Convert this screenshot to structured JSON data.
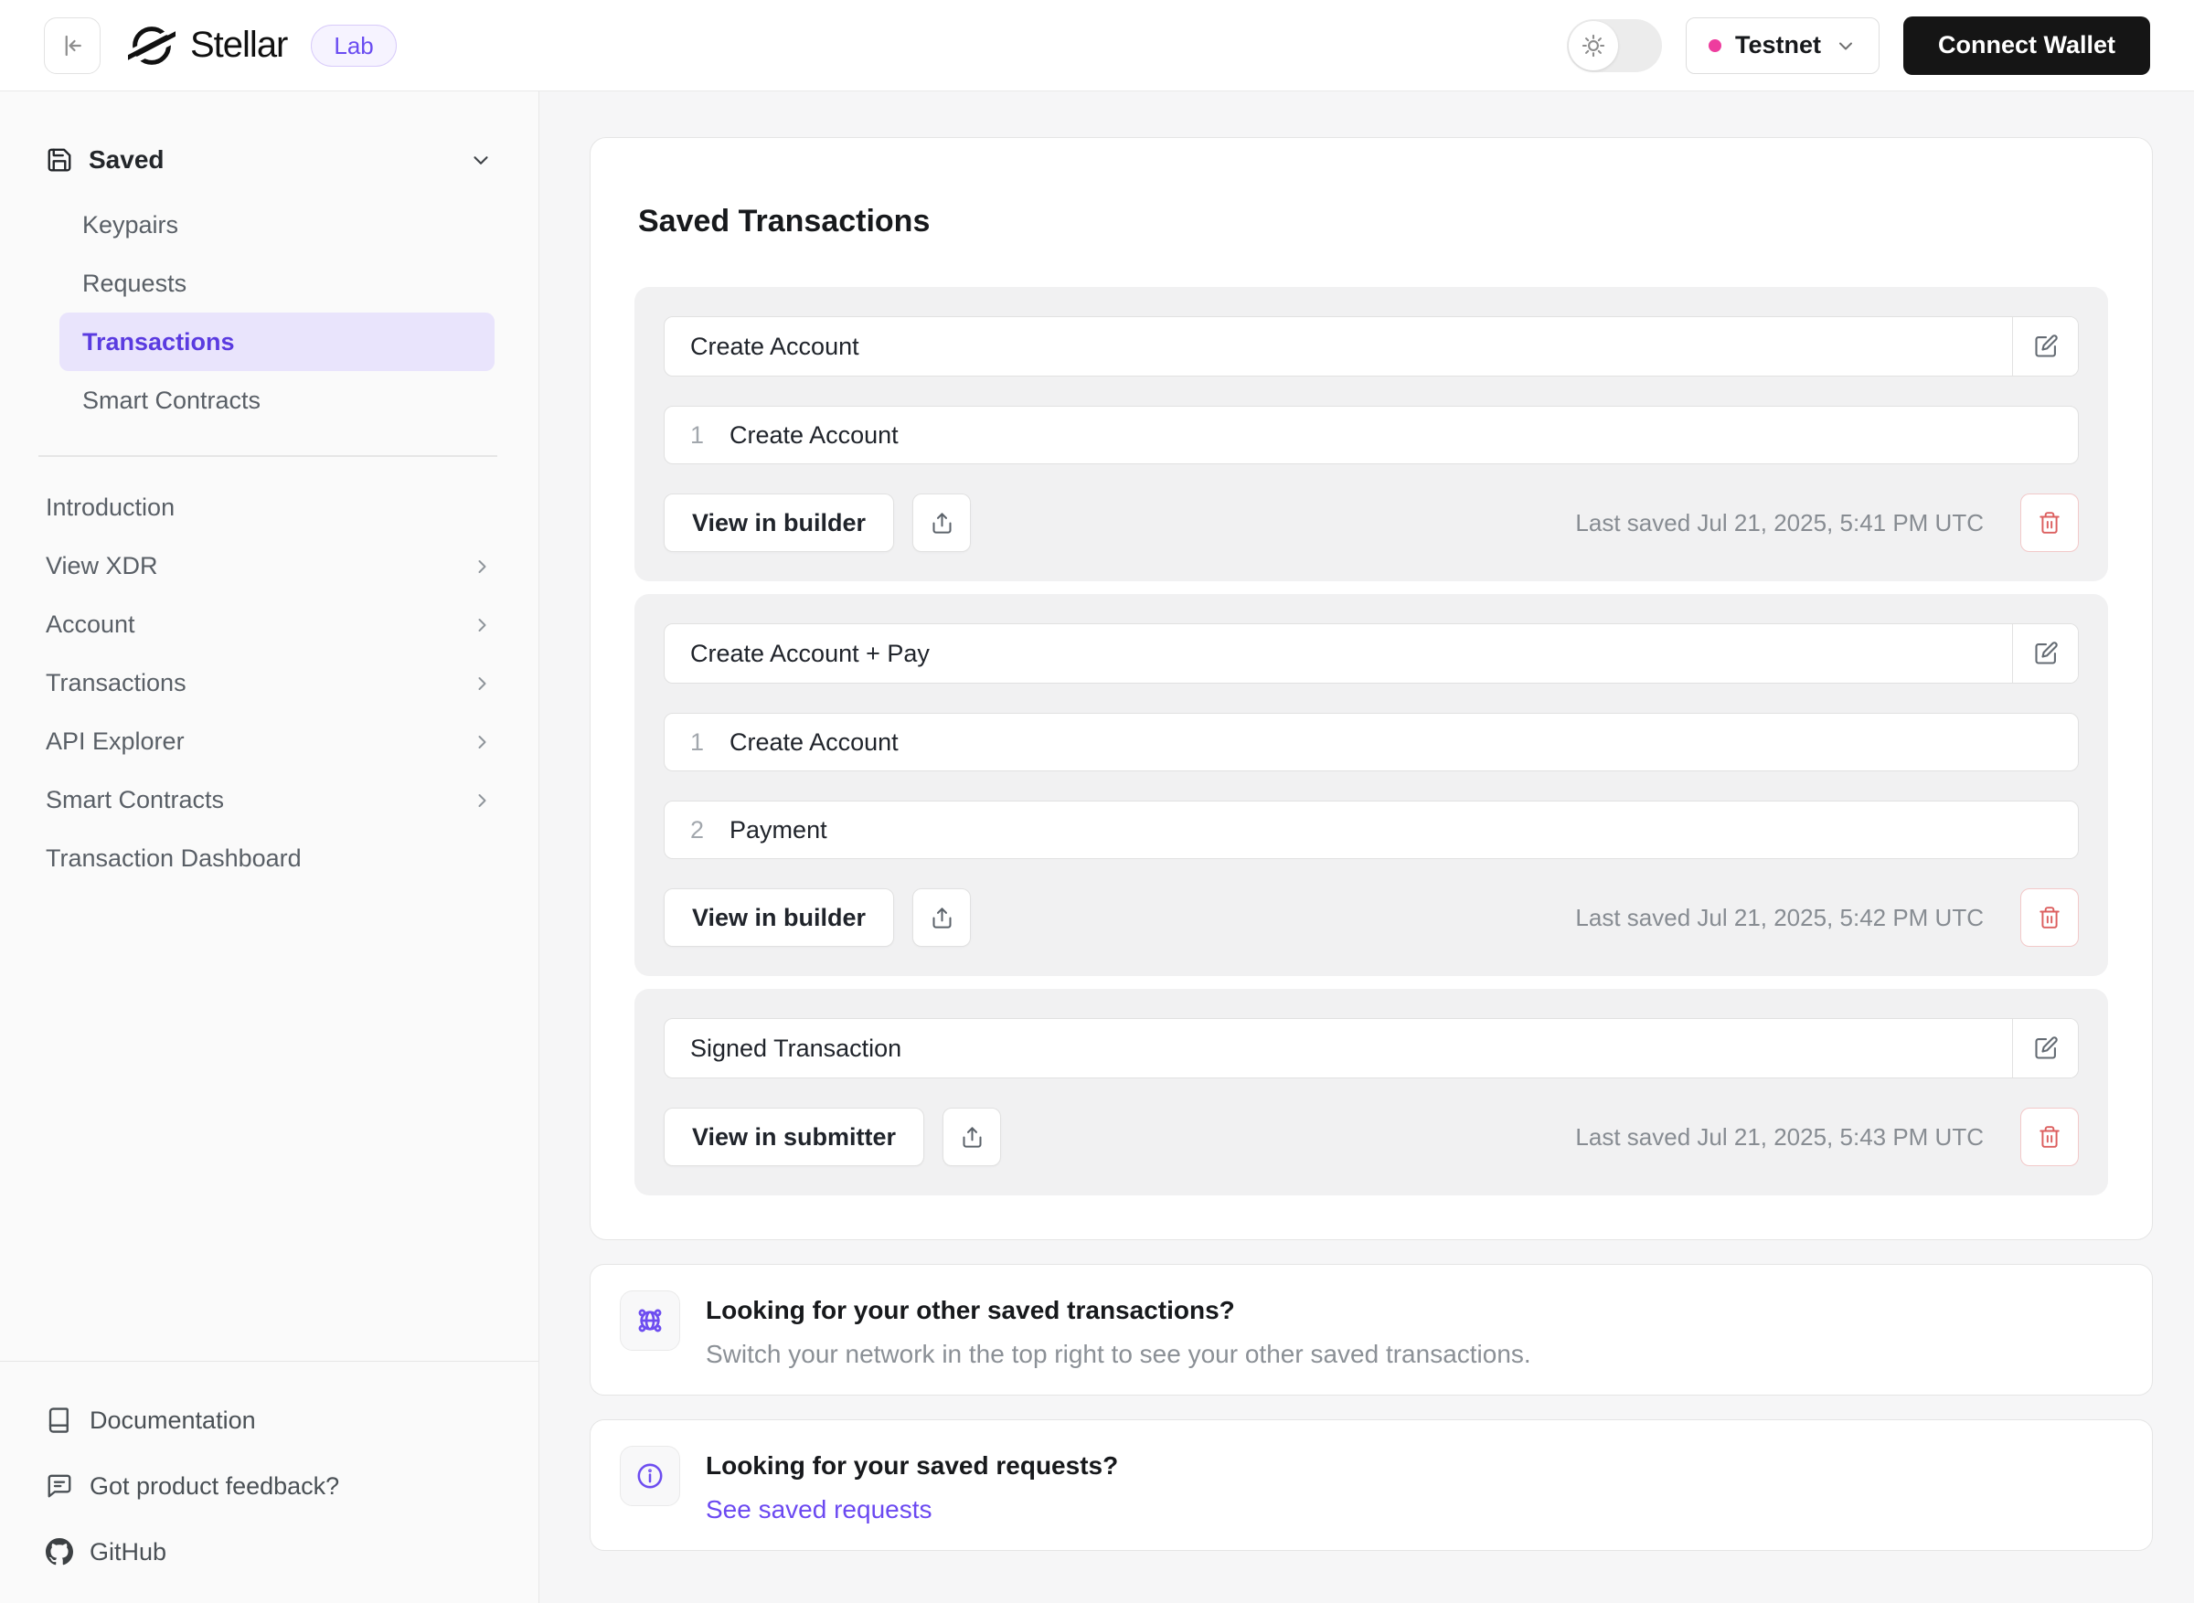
{
  "header": {
    "brand": "Stellar",
    "badge": "Lab",
    "network_label": "Testnet",
    "connect_wallet": "Connect Wallet"
  },
  "sidebar": {
    "saved": {
      "label": "Saved",
      "items": [
        {
          "label": "Keypairs"
        },
        {
          "label": "Requests"
        },
        {
          "label": "Transactions"
        },
        {
          "label": "Smart Contracts"
        }
      ]
    },
    "nav": [
      {
        "label": "Introduction"
      },
      {
        "label": "View XDR"
      },
      {
        "label": "Account"
      },
      {
        "label": "Transactions"
      },
      {
        "label": "API Explorer"
      },
      {
        "label": "Smart Contracts"
      },
      {
        "label": "Transaction Dashboard"
      }
    ],
    "footer": [
      {
        "label": "Documentation"
      },
      {
        "label": "Got product feedback?"
      },
      {
        "label": "GitHub"
      }
    ]
  },
  "main": {
    "title": "Saved Transactions",
    "transactions": [
      {
        "name": "Create Account",
        "operations": [
          {
            "index": "1",
            "label": "Create Account"
          }
        ],
        "action": "View in builder",
        "last_saved": "Last saved Jul 21, 2025, 5:41 PM UTC"
      },
      {
        "name": "Create Account + Pay",
        "operations": [
          {
            "index": "1",
            "label": "Create Account"
          },
          {
            "index": "2",
            "label": "Payment"
          }
        ],
        "action": "View in builder",
        "last_saved": "Last saved Jul 21, 2025, 5:42 PM UTC"
      },
      {
        "name": "Signed Transaction",
        "operations": [],
        "action": "View in submitter",
        "last_saved": "Last saved Jul 21, 2025, 5:43 PM UTC"
      }
    ],
    "info_boxes": [
      {
        "title": "Looking for your other saved transactions?",
        "description": "Switch your network in the top right to see your other saved transactions."
      },
      {
        "title": "Looking for your saved requests?",
        "link": "See saved requests"
      }
    ]
  },
  "colors": {
    "accent": "#5a3be0",
    "accent_bg": "#e9e4fc",
    "link": "#6b49f1",
    "network_dot": "#ee3d9e",
    "danger": "#dc5f5f",
    "danger_border": "#f2c9c9",
    "connect_wallet_bg": "#151515"
  }
}
